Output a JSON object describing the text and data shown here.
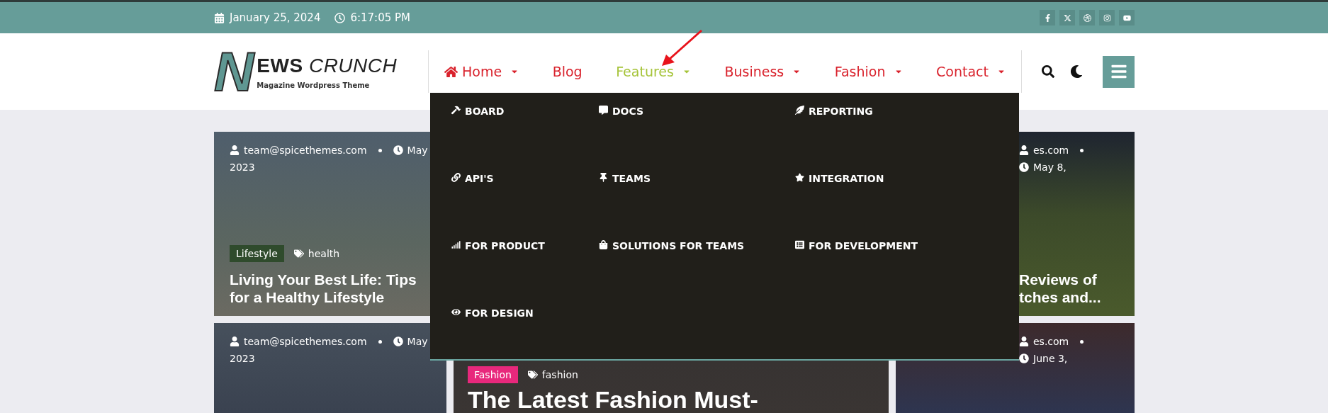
{
  "top_bar": {
    "date": "January 25, 2024",
    "time": "6:17:05 PM",
    "social": [
      {
        "kind": "facebook"
      },
      {
        "kind": "x"
      },
      {
        "kind": "dribbble"
      },
      {
        "kind": "instagram"
      },
      {
        "kind": "youtube"
      }
    ]
  },
  "logo": {
    "mark": "N",
    "name_bold": "EWS",
    "name_light": "CRUNCH",
    "tagline": "Magazine Wordpress Theme"
  },
  "nav": [
    {
      "label": "Home",
      "selected": false,
      "dropdown": true,
      "home_icon": true
    },
    {
      "label": "Blog",
      "selected": false,
      "dropdown": false,
      "home_icon": false
    },
    {
      "label": "Features",
      "selected": true,
      "dropdown": true,
      "home_icon": false
    },
    {
      "label": "Business",
      "selected": false,
      "dropdown": true,
      "home_icon": false
    },
    {
      "label": "Fashion",
      "selected": false,
      "dropdown": true,
      "home_icon": false
    },
    {
      "label": "Contact",
      "selected": false,
      "dropdown": true,
      "home_icon": false
    }
  ],
  "mega_menu": [
    "BOARD",
    "DOCS",
    "REPORTING",
    "API'S",
    "TEAMS",
    "INTEGRATION",
    "FOR PRODUCT",
    "SOLUTIONS FOR TEAMS",
    "FOR DEVELOPMENT",
    "FOR DESIGN"
  ],
  "posts": [
    {
      "kind": "left_top",
      "author": "team@spicethemes.com",
      "date": "May",
      "year": "2023",
      "category": {
        "label": "Lifestyle",
        "color": "#2f4b2c"
      },
      "tag": "health",
      "title": [
        "Living Your Best Life: Tips for a Healthy Lifestyle"
      ]
    },
    {
      "kind": "middle",
      "category": {
        "label": "Fashion",
        "color": "#e8287c"
      },
      "tag": "fashion",
      "title": [
        "The Latest Fashion Must-"
      ]
    },
    {
      "kind": "right_top",
      "author": "es.com",
      "date": "May 8,",
      "title": [
        "Reviews of",
        "tches and..."
      ]
    },
    {
      "kind": "left_bottom",
      "author": "team@spicethemes.com",
      "date": "May",
      "year": "2023"
    },
    {
      "kind": "right_bottom",
      "author": "es.com",
      "date": "June 3,"
    }
  ]
}
